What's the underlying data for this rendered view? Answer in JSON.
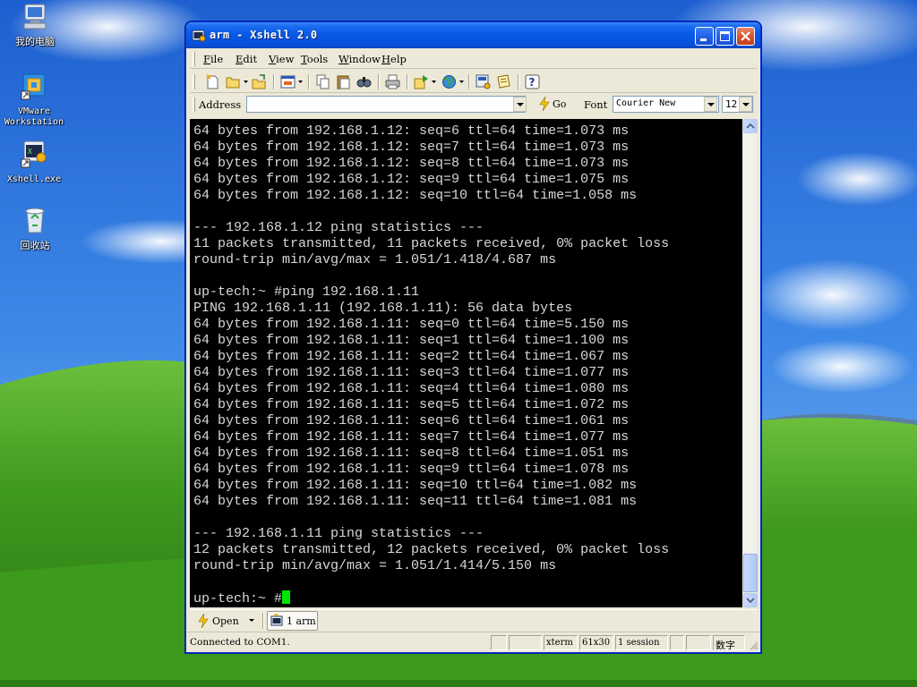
{
  "desktop": {
    "icons": [
      {
        "label": "我的电脑",
        "icon": "my-computer-icon"
      },
      {
        "label": "VMware\nWorkstation",
        "icon": "vmware-icon"
      },
      {
        "label": "Xshell.exe",
        "icon": "xshell-shortcut-icon"
      },
      {
        "label": "回收站",
        "icon": "recycle-bin-icon"
      }
    ]
  },
  "window": {
    "title": "arm - Xshell 2.0",
    "menu": [
      "File",
      "Edit",
      "View",
      "Tools",
      "Window",
      "Help"
    ],
    "address_label": "Address",
    "address_value": "",
    "go_label": "Go",
    "font_label": "Font",
    "font_value": "Courier New",
    "font_size": "12"
  },
  "terminal": {
    "lines": [
      "64 bytes from 192.168.1.12: seq=6 ttl=64 time=1.073 ms",
      "64 bytes from 192.168.1.12: seq=7 ttl=64 time=1.073 ms",
      "64 bytes from 192.168.1.12: seq=8 ttl=64 time=1.073 ms",
      "64 bytes from 192.168.1.12: seq=9 ttl=64 time=1.075 ms",
      "64 bytes from 192.168.1.12: seq=10 ttl=64 time=1.058 ms",
      "",
      "--- 192.168.1.12 ping statistics ---",
      "11 packets transmitted, 11 packets received, 0% packet loss",
      "round-trip min/avg/max = 1.051/1.418/4.687 ms",
      "",
      "up-tech:~ #ping 192.168.1.11",
      "PING 192.168.1.11 (192.168.1.11): 56 data bytes",
      "64 bytes from 192.168.1.11: seq=0 ttl=64 time=5.150 ms",
      "64 bytes from 192.168.1.11: seq=1 ttl=64 time=1.100 ms",
      "64 bytes from 192.168.1.11: seq=2 ttl=64 time=1.067 ms",
      "64 bytes from 192.168.1.11: seq=3 ttl=64 time=1.077 ms",
      "64 bytes from 192.168.1.11: seq=4 ttl=64 time=1.080 ms",
      "64 bytes from 192.168.1.11: seq=5 ttl=64 time=1.072 ms",
      "64 bytes from 192.168.1.11: seq=6 ttl=64 time=1.061 ms",
      "64 bytes from 192.168.1.11: seq=7 ttl=64 time=1.077 ms",
      "64 bytes from 192.168.1.11: seq=8 ttl=64 time=1.051 ms",
      "64 bytes from 192.168.1.11: seq=9 ttl=64 time=1.078 ms",
      "64 bytes from 192.168.1.11: seq=10 ttl=64 time=1.082 ms",
      "64 bytes from 192.168.1.11: seq=11 ttl=64 time=1.081 ms",
      "",
      "--- 192.168.1.11 ping statistics ---",
      "12 packets transmitted, 12 packets received, 0% packet loss",
      "round-trip min/avg/max = 1.051/1.414/5.150 ms",
      ""
    ],
    "prompt": "up-tech:~ #",
    "text_color": "#d8d8d8",
    "cursor_color": "#00e600"
  },
  "sessions": {
    "open_label": "Open",
    "tabs": [
      {
        "label": "1 arm"
      }
    ]
  },
  "statusbar": {
    "text": "Connected to COM1.",
    "terminal_type": "xterm",
    "size": "61x30",
    "sessions": "1 session",
    "input_mode": "数字"
  }
}
